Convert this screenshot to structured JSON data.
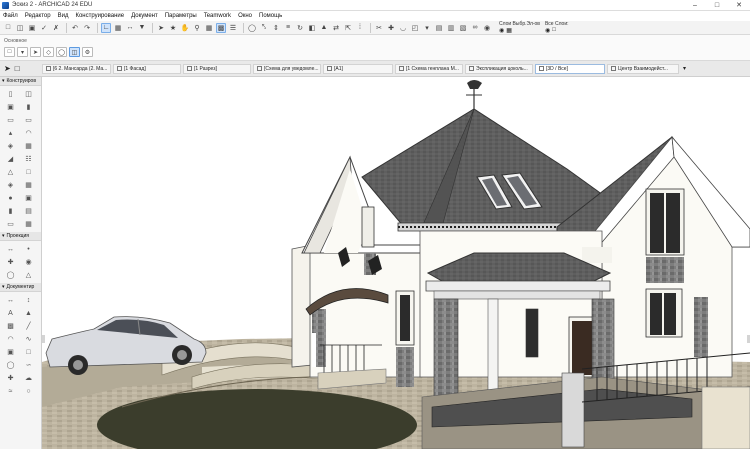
{
  "window": {
    "title": "Эскиз 2 - ARCHICAD 24 EDU"
  },
  "menu": [
    "Файл",
    "Редактор",
    "Вид",
    "Конструирование",
    "Документ",
    "Параметры",
    "Teamwork",
    "Окно",
    "Помощь"
  ],
  "toolbar": {
    "layer_combo_label": "Слои Выбр.Эл-ов",
    "all_layers_label": "Все Слои:"
  },
  "infobox": {
    "label": "Основное"
  },
  "tabs": [
    {
      "label": "[6 2. Мансарда (2. Ма...",
      "active": false
    },
    {
      "label": "[1 Фасад]",
      "active": false
    },
    {
      "label": "[1 Разрез]",
      "active": false
    },
    {
      "label": "[Схема для уведомле...",
      "active": false
    },
    {
      "label": "[A1]",
      "active": false
    },
    {
      "label": "[1 Схема генплана М...",
      "active": false
    },
    {
      "label": "Экспликация цоколь...",
      "active": false
    },
    {
      "label": "[3D / Все]",
      "active": true
    },
    {
      "label": "Центр Взаимодейст...",
      "active": false
    }
  ],
  "toolbox": {
    "sections": [
      {
        "title": "Конструиров",
        "tool_count": 22
      },
      {
        "title": "Проекция",
        "tool_count": 6
      },
      {
        "title": "Документир",
        "tool_count": 16
      }
    ]
  },
  "colors": {
    "roof": "#5e5e5e",
    "wall": "#fafafa",
    "stone": "#808080",
    "lawn": "#3a3d2c",
    "paving": "#b9b09c",
    "accent": "#cfe3fb"
  }
}
